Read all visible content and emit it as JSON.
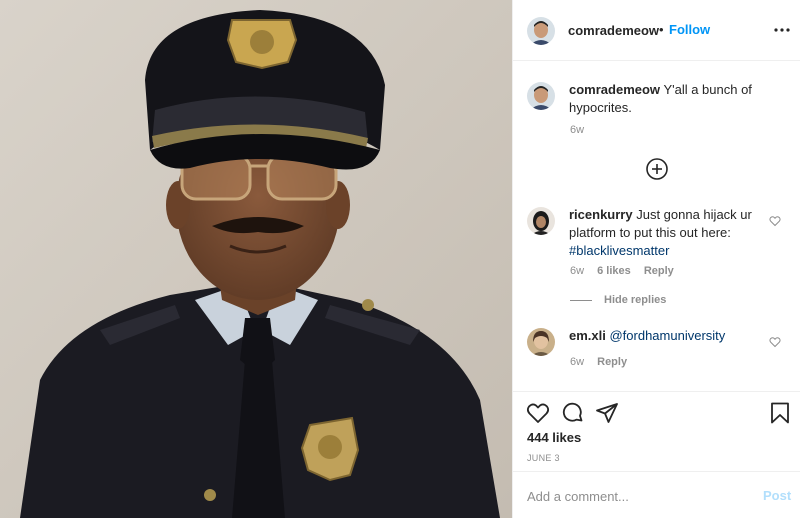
{
  "post": {
    "image_subject": "police-officer-portrait",
    "header": {
      "username": "comrademeow",
      "separator": "•",
      "follow_label": "Follow",
      "more_icon": "more-options-icon"
    },
    "comments": [
      {
        "username": "comrademeow",
        "text": "Y'all a bunch of hypocrites.",
        "time": "6w"
      },
      {
        "username": "ricenkurry",
        "text": "Just gonna hijack ur platform to put this out here: ",
        "hashtag": "#blacklivesmatter",
        "time": "6w",
        "likes": "6 likes",
        "reply_label": "Reply"
      },
      {
        "username": "em.xli",
        "mention": "@fordhamuniversity",
        "time": "6w",
        "reply_label": "Reply"
      }
    ],
    "hide_replies_label": "Hide replies",
    "likes_count": "444 likes",
    "date": "JUNE 3",
    "add_comment_placeholder": "Add a comment...",
    "post_label": "Post",
    "colors": {
      "link_blue": "#0095f6",
      "hashtag_blue": "#00376b",
      "muted": "#8e8e8e",
      "post_disabled": "#b2dffc"
    }
  }
}
